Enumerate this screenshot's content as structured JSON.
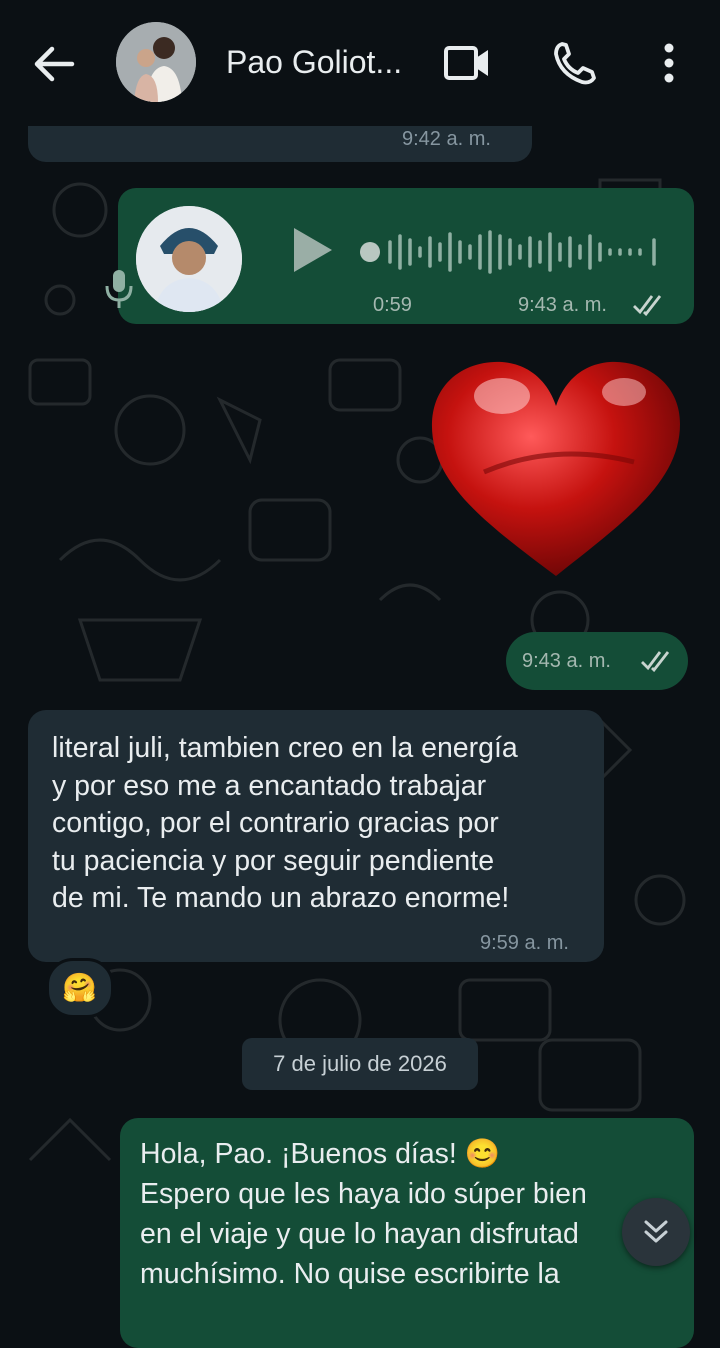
{
  "header": {
    "contact_name": "Pao Goliot...",
    "back_icon": "arrow-left-icon",
    "video_icon": "video-call-icon",
    "call_icon": "phone-icon",
    "menu_icon": "more-vert-icon"
  },
  "messages": {
    "previous_time": "9:42 a. m.",
    "voice": {
      "duration": "0:59",
      "time": "9:43 a. m.",
      "status_icon": "double-check-icon"
    },
    "sticker": {
      "icon": "red-heart-sticker",
      "time": "9:43 a. m."
    },
    "incoming": {
      "lines": [
        "literal juli, tambien creo en la energía",
        "y por eso me a encantado trabajar",
        "contigo, por el contrario gracias por",
        "tu paciencia y por seguir pendiente",
        "de mi. Te mando un abrazo enorme!"
      ],
      "time": "9:59 a. m.",
      "reaction": "🤗"
    },
    "date_divider": "7 de julio de 2026",
    "outgoing_last": {
      "lines": [
        "Hola, Pao. ¡Buenos días! 😊",
        "Espero que les haya ido súper bien",
        "en el viaje y que lo hayan disfrutad",
        "muchísimo. No quise escribirte la"
      ]
    }
  },
  "colors": {
    "background": "#0b1014",
    "outgoing_bubble": "#144d37",
    "incoming_bubble": "#1f2c34",
    "text": "#e9edef"
  }
}
